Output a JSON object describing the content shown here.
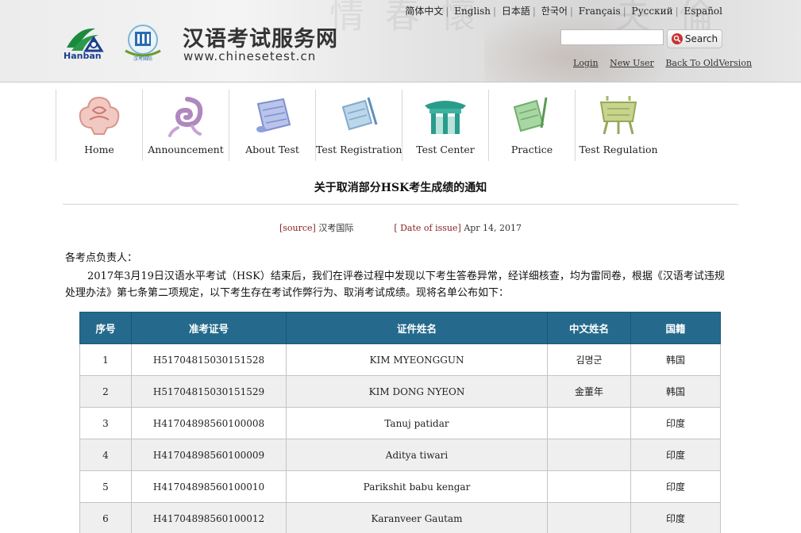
{
  "header": {
    "logo_text": "Hanban",
    "logo_hsk_caption": "汉考国际",
    "site_title": "汉语考试服务网",
    "site_url": "www.chinesetest.cn",
    "languages": [
      "简体中文",
      "English",
      "日本語",
      "한국어",
      "Français",
      "Русский",
      "Español"
    ],
    "search": {
      "placeholder": "",
      "button_label": "Search"
    },
    "links": {
      "login": "Login",
      "new_user": "New User",
      "old_version": "Back To OldVersion"
    }
  },
  "nav": [
    {
      "label": "Home",
      "icon": "home-knot-icon"
    },
    {
      "label": "Announcement",
      "icon": "announcement-swirl-icon"
    },
    {
      "label": "About Test",
      "icon": "about-scroll-icon"
    },
    {
      "label": "Test Registration",
      "icon": "registration-scroll-icon"
    },
    {
      "label": "Test Center",
      "icon": "test-center-gate-icon"
    },
    {
      "label": "Practice",
      "icon": "practice-scroll-icon"
    },
    {
      "label": "Test Regulation",
      "icon": "regulation-vessel-icon"
    }
  ],
  "article": {
    "title": "关于取消部分HSK考生成绩的通知",
    "source_label": "[source]",
    "source_value": "汉考国际",
    "date_label": "[ Date of issue]",
    "date_value": "Apr 14, 2017",
    "salutation": "各考点负责人：",
    "body": "2017年3月19日汉语水平考试（HSK）结束后，我们在评卷过程中发现以下考生答卷异常，经详细核查，均为雷同卷，根据《汉语考试违规处理办法》第七条第二项规定，以下考生存在考试作弊行为、取消考试成绩。现将名单公布如下："
  },
  "table": {
    "headers": [
      "序号",
      "准考证号",
      "证件姓名",
      "中文姓名",
      "国籍"
    ],
    "rows": [
      [
        "1",
        "H51704815030151528",
        "KIM MYEONGGUN",
        "김명군",
        "韩国"
      ],
      [
        "2",
        "H51704815030151529",
        "KIM DONG NYEON",
        "金董年",
        "韩国"
      ],
      [
        "3",
        "H41704898560100008",
        "Tanuj patidar",
        "",
        "印度"
      ],
      [
        "4",
        "H41704898560100009",
        "Aditya tiwari",
        "",
        "印度"
      ],
      [
        "5",
        "H41704898560100010",
        "Parikshit babu kengar",
        "",
        "印度"
      ],
      [
        "6",
        "H41704898560100012",
        "Karanveer Gautam",
        "",
        "印度"
      ]
    ]
  },
  "colors": {
    "table_header": "#256a8c",
    "source_label": "#8a2222",
    "search_icon": "#c83232"
  }
}
